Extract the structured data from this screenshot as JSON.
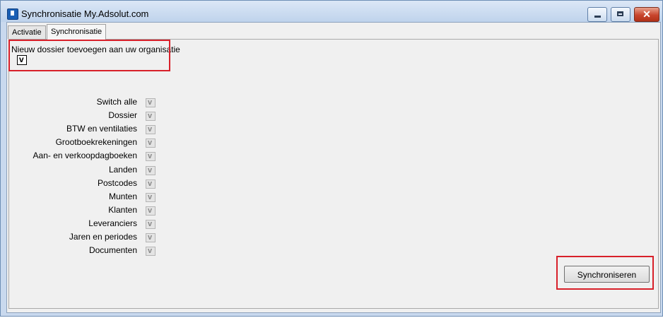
{
  "window": {
    "title": "Synchronisatie My.Adsolut.com"
  },
  "tabs": [
    {
      "label": "Activatie"
    },
    {
      "label": "Synchronisatie"
    }
  ],
  "new_dossier": {
    "label": "Nieuw dossier toevoegen aan uw organisatie",
    "checked": true
  },
  "sync_items": [
    {
      "label": "Switch alle",
      "checked": true
    },
    {
      "label": "Dossier",
      "checked": true
    },
    {
      "label": "BTW en ventilaties",
      "checked": true
    },
    {
      "label": "Grootboekrekeningen",
      "checked": true
    },
    {
      "label": "Aan- en verkoopdagboeken",
      "checked": true
    },
    {
      "label": "Landen",
      "checked": true
    },
    {
      "label": "Postcodes",
      "checked": true
    },
    {
      "label": "Munten",
      "checked": true
    },
    {
      "label": "Klanten",
      "checked": true
    },
    {
      "label": "Leveranciers",
      "checked": true
    },
    {
      "label": "Jaren en periodes",
      "checked": true
    },
    {
      "label": "Documenten",
      "checked": true
    }
  ],
  "buttons": {
    "synchronize": "Synchroniseren"
  },
  "colors": {
    "highlight": "#d8202a",
    "titlebar": "#c9d9ee"
  }
}
